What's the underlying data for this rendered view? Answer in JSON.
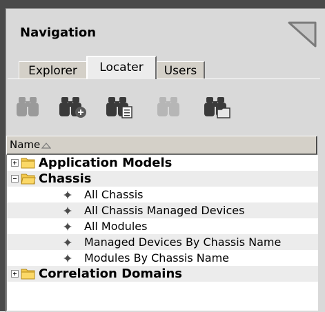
{
  "panel": {
    "title": "Navigation"
  },
  "tabs": [
    {
      "label": "Explorer",
      "active": false
    },
    {
      "label": "Locater",
      "active": true
    },
    {
      "label": "Users",
      "active": false
    }
  ],
  "toolbar": {
    "buttons": [
      {
        "icon": "binoculars-icon",
        "enabled": false
      },
      {
        "icon": "binoculars-add-icon",
        "enabled": true
      },
      {
        "icon": "binoculars-list-icon",
        "enabled": true
      },
      {
        "icon": "binoculars-icon",
        "enabled": false
      },
      {
        "icon": "binoculars-folder-icon",
        "enabled": true
      }
    ]
  },
  "column_header": {
    "label": "Name",
    "sort": "ascending"
  },
  "tree": {
    "nodes": [
      {
        "label": "Application Models",
        "type": "folder",
        "expanded": false
      },
      {
        "label": "Chassis",
        "type": "folder",
        "expanded": true
      },
      {
        "label": "All Chassis",
        "type": "search"
      },
      {
        "label": "All Chassis Managed Devices",
        "type": "search"
      },
      {
        "label": "All Modules",
        "type": "search"
      },
      {
        "label": "Managed Devices By Chassis Name",
        "type": "search"
      },
      {
        "label": "Modules By Chassis Name",
        "type": "search"
      },
      {
        "label": "Correlation Domains",
        "type": "folder",
        "expanded": false
      }
    ]
  },
  "colors": {
    "panel_bg": "#d9d9d9",
    "folder_yellow": "#f3c84b",
    "row_alt": "#ececec"
  }
}
